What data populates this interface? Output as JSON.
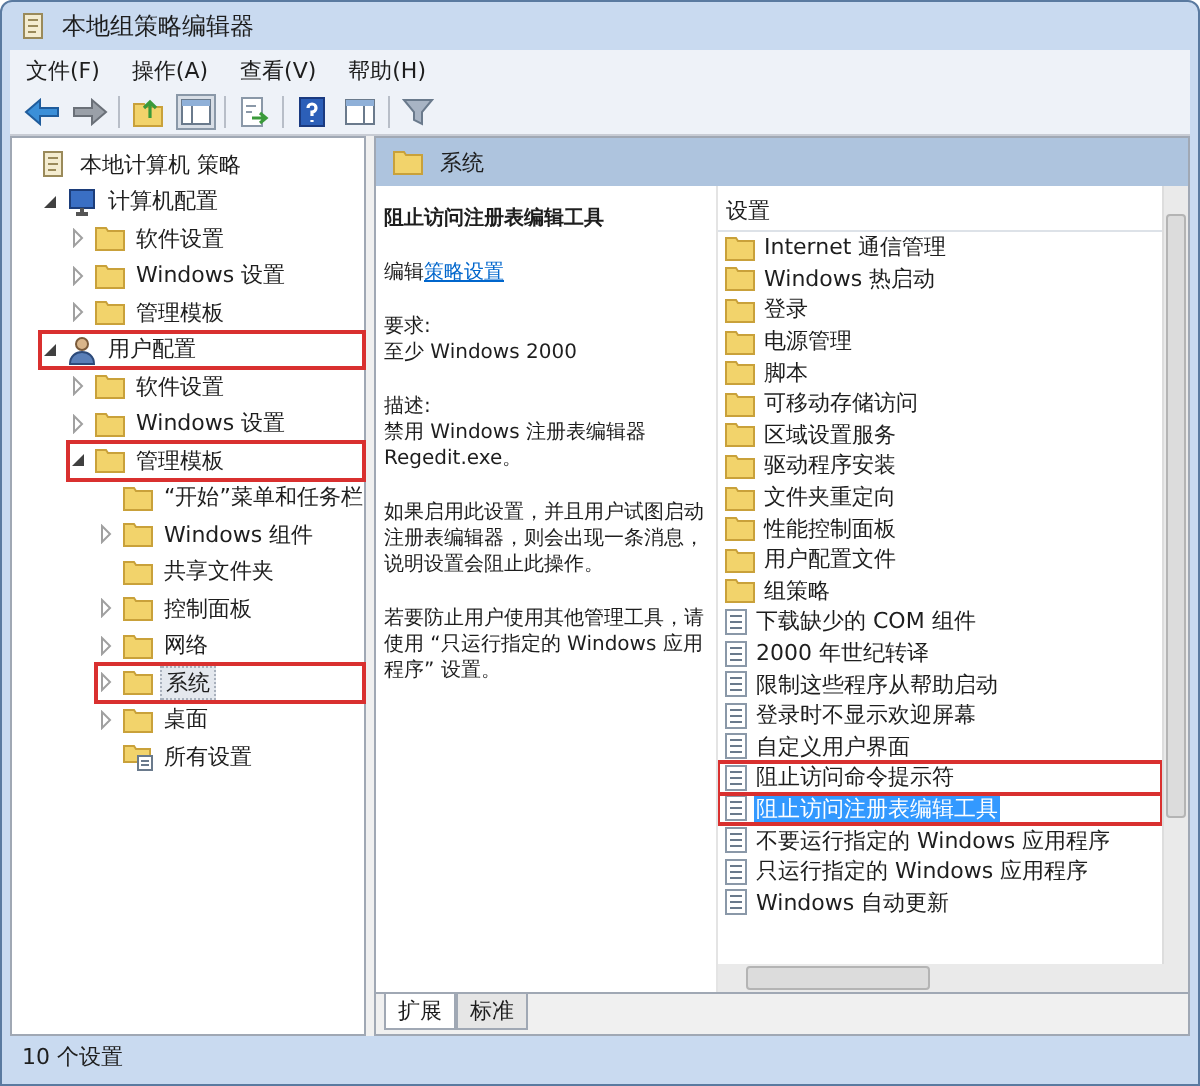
{
  "window": {
    "title": "本地组策略编辑器"
  },
  "menu": [
    "文件(F)",
    "操作(A)",
    "查看(V)",
    "帮助(H)"
  ],
  "toolbar": [
    {
      "kind": "back"
    },
    {
      "kind": "forward"
    },
    {
      "kind": "sep"
    },
    {
      "kind": "up"
    },
    {
      "kind": "tree",
      "selected": true
    },
    {
      "kind": "sep"
    },
    {
      "kind": "export",
      "selected": false
    },
    {
      "kind": "sep"
    },
    {
      "kind": "help",
      "selected": false
    },
    {
      "kind": "pane",
      "selected": false
    },
    {
      "kind": "sep"
    },
    {
      "kind": "filter",
      "selected": false
    }
  ],
  "tree": [
    {
      "label": "本地计算机 策略",
      "kind": "policy",
      "selected": false,
      "highlighted": false,
      "children": [
        {
          "label": "计算机配置",
          "kind": "computer",
          "expanded": true,
          "selected": false,
          "highlighted": false,
          "children": [
            {
              "label": "软件设置",
              "kind": "folder",
              "expanded": false,
              "selected": false,
              "highlighted": false
            },
            {
              "label": "Windows 设置",
              "kind": "folder",
              "expanded": false,
              "selected": false,
              "highlighted": false
            },
            {
              "label": "管理模板",
              "kind": "folder",
              "expanded": false,
              "selected": false,
              "highlighted": false
            }
          ]
        },
        {
          "label": "用户配置",
          "kind": "user",
          "expanded": true,
          "selected": false,
          "highlighted": true,
          "children": [
            {
              "label": "软件设置",
              "kind": "folder",
              "expanded": false,
              "selected": false,
              "highlighted": false
            },
            {
              "label": "Windows 设置",
              "kind": "folder",
              "expanded": false,
              "selected": false,
              "highlighted": false
            },
            {
              "label": "管理模板",
              "kind": "folder",
              "expanded": true,
              "selected": false,
              "highlighted": true,
              "children": [
                {
                  "label": "“开始”菜单和任务栏",
                  "kind": "folder",
                  "selected": false,
                  "highlighted": false
                },
                {
                  "label": "Windows 组件",
                  "kind": "folder",
                  "expanded": false,
                  "selected": false,
                  "highlighted": false
                },
                {
                  "label": "共享文件夹",
                  "kind": "folder",
                  "selected": false,
                  "highlighted": false
                },
                {
                  "label": "控制面板",
                  "kind": "folder",
                  "expanded": false,
                  "selected": false,
                  "highlighted": false
                },
                {
                  "label": "网络",
                  "kind": "folder",
                  "expanded": false,
                  "selected": false,
                  "highlighted": false
                },
                {
                  "label": "系统",
                  "kind": "folder",
                  "expanded": false,
                  "selected": true,
                  "highlighted": true
                },
                {
                  "label": "桌面",
                  "kind": "folder",
                  "expanded": false,
                  "selected": false,
                  "highlighted": false
                },
                {
                  "label": "所有设置",
                  "kind": "settings",
                  "selected": false,
                  "highlighted": false
                }
              ]
            }
          ]
        }
      ]
    }
  ],
  "header": {
    "title": "系统"
  },
  "description": {
    "title": "阻止访问注册表编辑工具",
    "edit_prefix": "编辑",
    "edit_link": "策略设置",
    "requirements_label": "要求:",
    "requirements": "至少 Windows 2000",
    "description_label": "描述:",
    "paragraphs": [
      "禁用 Windows 注册表编辑器 Regedit.exe。",
      "如果启用此设置，并且用户试图启动注册表编辑器，则会出现一条消息，说明设置会阻止此操作。",
      "若要防止用户使用其他管理工具，请使用 “只运行指定的 Windows 应用程序” 设置。"
    ]
  },
  "list": {
    "column": "设置",
    "items": [
      {
        "label": "Internet 通信管理",
        "kind": "folder",
        "selected": false,
        "highlighted": false
      },
      {
        "label": "Windows 热启动",
        "kind": "folder",
        "selected": false,
        "highlighted": false
      },
      {
        "label": "登录",
        "kind": "folder",
        "selected": false,
        "highlighted": false
      },
      {
        "label": "电源管理",
        "kind": "folder",
        "selected": false,
        "highlighted": false
      },
      {
        "label": "脚本",
        "kind": "folder",
        "selected": false,
        "highlighted": false
      },
      {
        "label": "可移动存储访问",
        "kind": "folder",
        "selected": false,
        "highlighted": false
      },
      {
        "label": "区域设置服务",
        "kind": "folder",
        "selected": false,
        "highlighted": false
      },
      {
        "label": "驱动程序安装",
        "kind": "folder",
        "selected": false,
        "highlighted": false
      },
      {
        "label": "文件夹重定向",
        "kind": "folder",
        "selected": false,
        "highlighted": false
      },
      {
        "label": "性能控制面板",
        "kind": "folder",
        "selected": false,
        "highlighted": false
      },
      {
        "label": "用户配置文件",
        "kind": "folder",
        "selected": false,
        "highlighted": false
      },
      {
        "label": "组策略",
        "kind": "folder",
        "selected": false,
        "highlighted": false
      },
      {
        "label": "下载缺少的 COM 组件",
        "kind": "setting",
        "selected": false,
        "highlighted": false
      },
      {
        "label": "2000 年世纪转译",
        "kind": "setting",
        "selected": false,
        "highlighted": false
      },
      {
        "label": "限制这些程序从帮助启动",
        "kind": "setting",
        "selected": false,
        "highlighted": false
      },
      {
        "label": "登录时不显示欢迎屏幕",
        "kind": "setting",
        "selected": false,
        "highlighted": false
      },
      {
        "label": "自定义用户界面",
        "kind": "setting",
        "selected": false,
        "highlighted": false
      },
      {
        "label": "阻止访问命令提示符",
        "kind": "setting",
        "selected": false,
        "highlighted": true
      },
      {
        "label": "阻止访问注册表编辑工具",
        "kind": "setting",
        "selected": true,
        "highlighted": true
      },
      {
        "label": "不要运行指定的 Windows 应用程序",
        "kind": "setting",
        "selected": false,
        "highlighted": false
      },
      {
        "label": "只运行指定的 Windows 应用程序",
        "kind": "setting",
        "selected": false,
        "highlighted": false
      },
      {
        "label": "Windows 自动更新",
        "kind": "setting",
        "selected": false,
        "highlighted": false
      }
    ]
  },
  "tabs": [
    {
      "label": "扩展",
      "selected": true
    },
    {
      "label": "标准",
      "selected": false
    }
  ],
  "status_bar": {
    "text": "10 个设置"
  }
}
